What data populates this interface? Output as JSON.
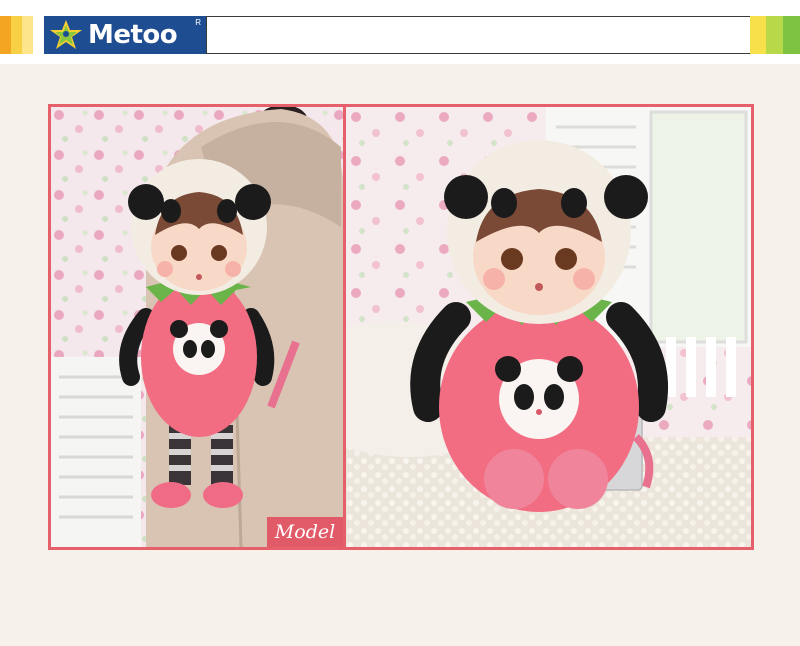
{
  "header": {
    "brand_name": "Metoo",
    "brand_registered_mark": "R",
    "logo_icon": "star-figure-icon",
    "colors": {
      "brand_blue": "#1f4d92",
      "stripe_left": [
        "#f4a623",
        "#f7d046",
        "#e85d8a",
        "#4fc6e8"
      ],
      "stripe_right": [
        "#f7e04a",
        "#b7d848",
        "#7ec242"
      ],
      "logo_star_green": "#8cc63f",
      "logo_star_yellow": "#f6d02f"
    }
  },
  "gallery": {
    "left_photo": {
      "caption": "Model"
    },
    "right_photo": {},
    "frame_color": "#e5606a"
  }
}
